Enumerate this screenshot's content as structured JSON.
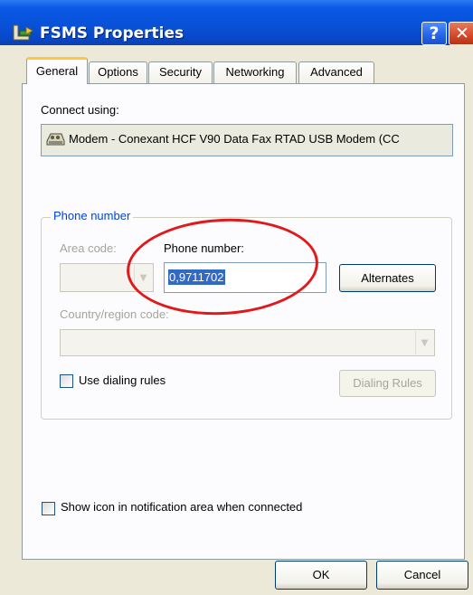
{
  "window": {
    "title": "FSMS Properties",
    "help_glyph": "?",
    "close_glyph": "✕"
  },
  "tabs": [
    {
      "label": "General",
      "active": true
    },
    {
      "label": "Options",
      "active": false
    },
    {
      "label": "Security",
      "active": false
    },
    {
      "label": "Networking",
      "active": false
    },
    {
      "label": "Advanced",
      "active": false
    }
  ],
  "general": {
    "connect_using_label": "Connect using:",
    "modem_name": "Modem - Conexant HCF V90 Data Fax RTAD USB Modem (CC",
    "modem_icon": "modem-icon",
    "phone_group": {
      "legend": "Phone number",
      "area_code_label": "Area code:",
      "area_code_value": "",
      "phone_number_label": "Phone number:",
      "phone_number_value": "0,9711702",
      "alternates_button": "Alternates",
      "country_label": "Country/region code:",
      "country_value": "",
      "use_dialing_rules_label": "Use dialing rules",
      "use_dialing_rules_checked": false,
      "dialing_rules_button": "Dialing Rules"
    },
    "show_icon_label": "Show icon in notification area when connected",
    "show_icon_checked": false
  },
  "footer": {
    "ok_label": "OK",
    "cancel_label": "Cancel"
  },
  "annotation": {
    "shape": "ellipse",
    "color": "#e01a1a"
  },
  "colors": {
    "titlebar": "#0852d8",
    "dialog_bg": "#ece9d8",
    "group_legend": "#0046d5",
    "selection": "#316ac5",
    "active_tab_accent": "#ffc83c"
  }
}
